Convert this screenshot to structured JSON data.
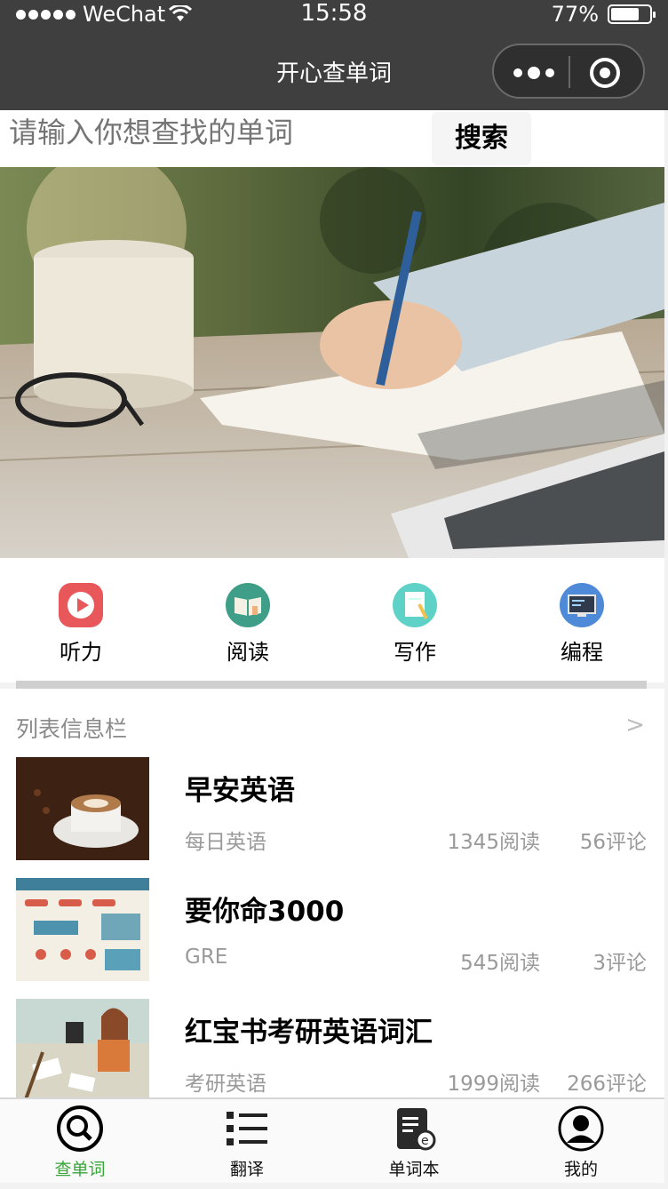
{
  "status_bar": {
    "carrier": "WeChat",
    "time": "15:58",
    "battery": "77%",
    "battery_level": 0.77
  },
  "nav": {
    "title": "开心查单词"
  },
  "search": {
    "placeholder": "请输入你想查找的单词",
    "button_label": "搜索"
  },
  "quick_nav": [
    {
      "label": "听力",
      "icon": "play-icon",
      "color": "#e8575a"
    },
    {
      "label": "阅读",
      "icon": "book-icon",
      "color": "#3f9e87"
    },
    {
      "label": "写作",
      "icon": "paper-pencil-icon",
      "color": "#5fd2c8"
    },
    {
      "label": "编程",
      "icon": "monitor-icon",
      "color": "#4f8ad8"
    }
  ],
  "list": {
    "header": "列表信息栏",
    "more": ">",
    "items": [
      {
        "title": "早安英语",
        "source": "每日英语",
        "reads": "1345阅读",
        "comments": "56评论",
        "thumb": "coffee-image"
      },
      {
        "title": "要你命3000",
        "source": "GRE",
        "reads": "545阅读",
        "comments": "3评论",
        "thumb": "gre-infographic-image"
      },
      {
        "title": "红宝书考研英语词汇",
        "source": "考研英语",
        "reads": "1999阅读",
        "comments": "266评论",
        "thumb": "study-illustration-image"
      }
    ]
  },
  "tabbar": {
    "active_color": "#3aa63a",
    "tabs": [
      {
        "label": "查单词",
        "icon": "search-icon",
        "active": true
      },
      {
        "label": "翻译",
        "icon": "list-icon",
        "active": false
      },
      {
        "label": "单词本",
        "icon": "notebook-icon",
        "active": false
      },
      {
        "label": "我的",
        "icon": "user-icon",
        "active": false
      }
    ]
  }
}
